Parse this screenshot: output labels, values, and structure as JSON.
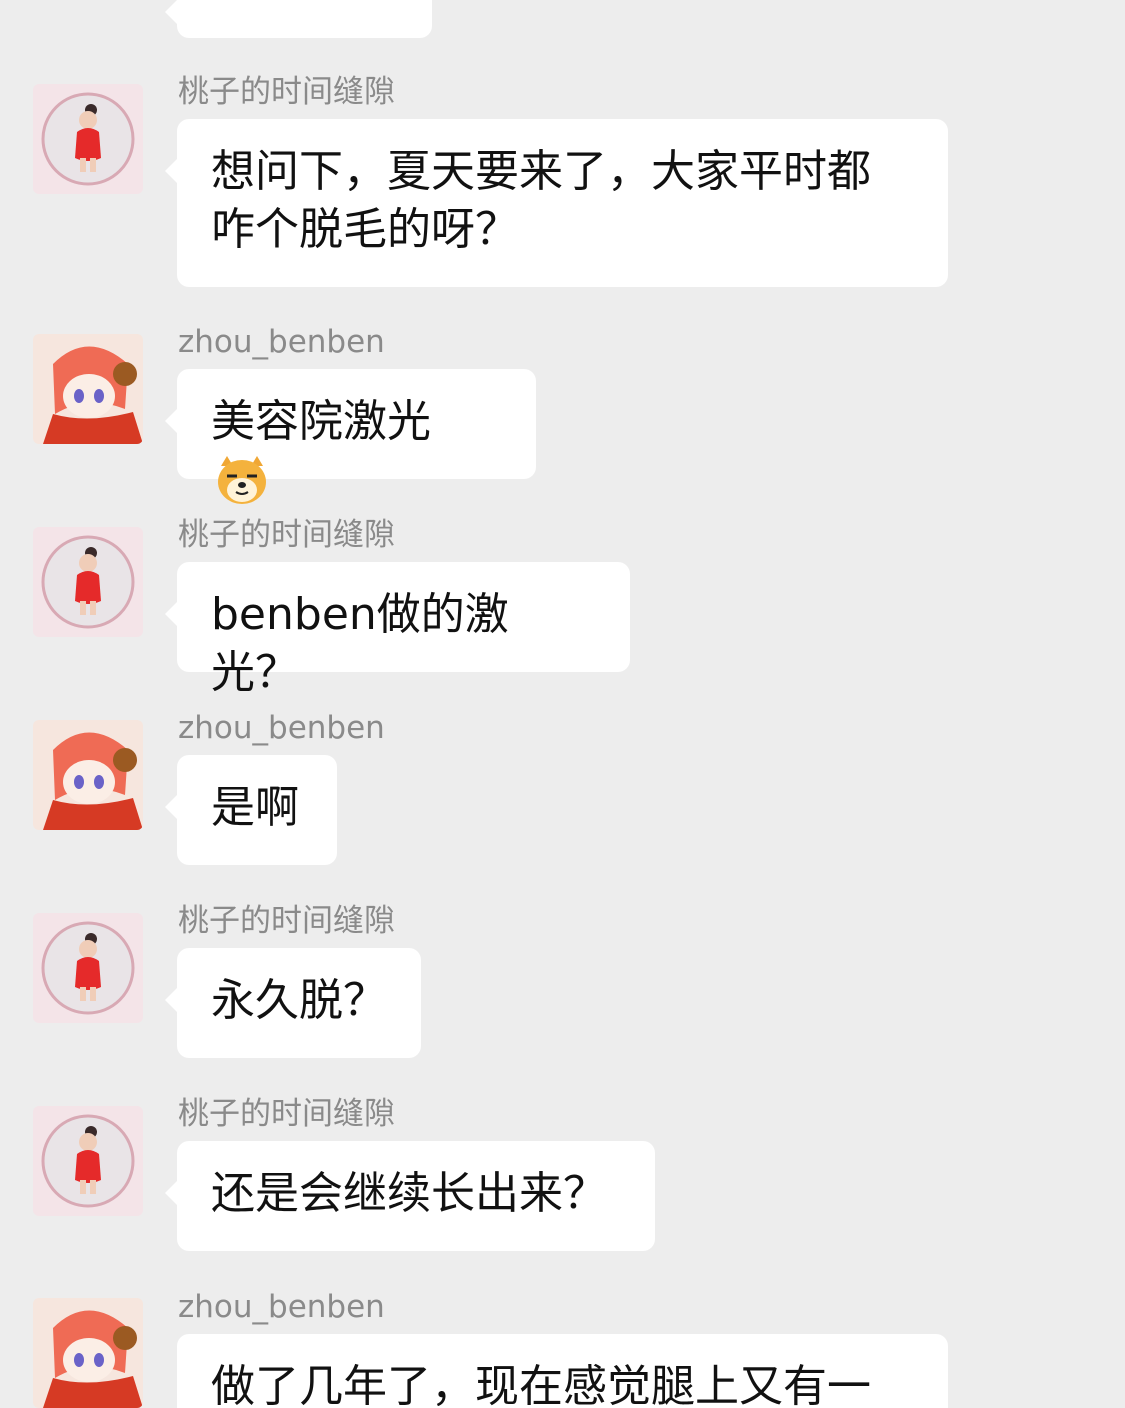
{
  "messages": [
    {
      "sender": "",
      "text": "",
      "avatar": "child-avatar"
    },
    {
      "sender": "桃子的时间缝隙",
      "text": "想问下，夏天要来了，大家平时都咋个脱毛的呀？",
      "avatar": "child-avatar"
    },
    {
      "sender": "zhou_benben",
      "text": "美容院激光",
      "emoji": "doge-emoji",
      "avatar": "anime-avatar"
    },
    {
      "sender": "桃子的时间缝隙",
      "text": "benben做的激光？",
      "avatar": "child-avatar"
    },
    {
      "sender": "zhou_benben",
      "text": "是啊",
      "avatar": "anime-avatar"
    },
    {
      "sender": "桃子的时间缝隙",
      "text": "永久脱？",
      "avatar": "child-avatar"
    },
    {
      "sender": "桃子的时间缝隙",
      "text": "还是会继续长出来？",
      "avatar": "child-avatar"
    },
    {
      "sender": "zhou_benben",
      "text": "做了几年了，现在感觉腿上又有一",
      "avatar": "anime-avatar"
    }
  ],
  "colors": {
    "background": "#ededed",
    "bubble": "#ffffff",
    "sender_text": "#8a8a8a",
    "message_text": "#111111"
  }
}
